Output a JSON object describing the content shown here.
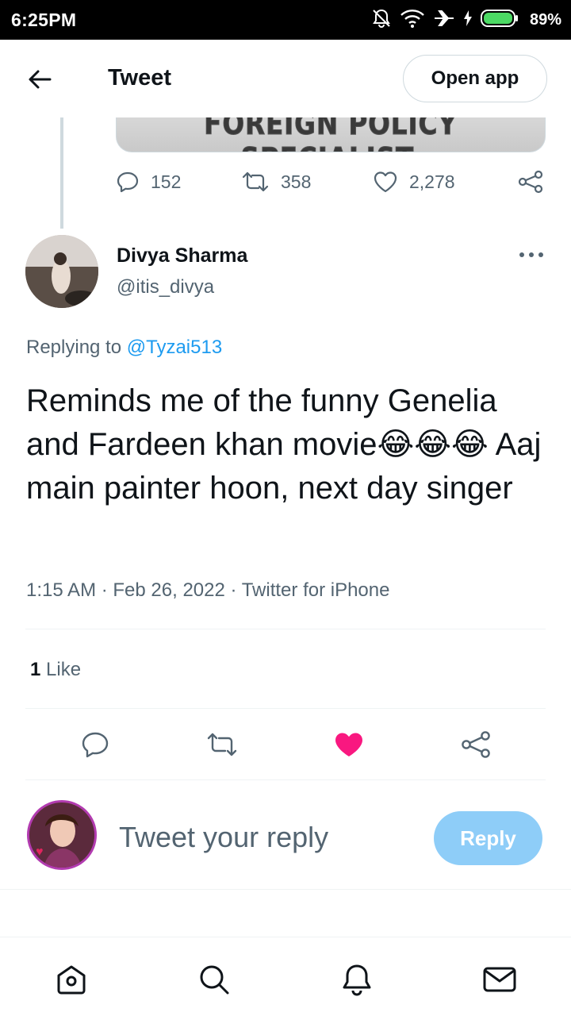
{
  "status_bar": {
    "time": "6:25PM",
    "battery_percent": "89%",
    "icons": [
      "mute-icon",
      "wifi-icon",
      "airplane-icon",
      "charging-icon",
      "battery-icon"
    ]
  },
  "header": {
    "title": "Tweet",
    "open_app_label": "Open app"
  },
  "parent_tweet": {
    "media_caption_text": "FOREIGN POLICY SPECIALIST.",
    "reply_count": "152",
    "retweet_count": "358",
    "like_count": "2,278"
  },
  "tweet": {
    "display_name": "Divya Sharma",
    "handle": "@itis_divya",
    "replying_prefix": "Replying to ",
    "replying_to": "@Tyzai513",
    "text": "Reminds me of the funny Genelia and Fardeen khan movie😂😂😂 Aaj main painter hoon, next day singer",
    "meta": "1:15 AM · Feb 26, 2022 · Twitter for iPhone",
    "likes_count": "1",
    "likes_label": " Like",
    "liked": true
  },
  "composer": {
    "placeholder": "Tweet your reply",
    "reply_button_label": "Reply"
  },
  "bottom_nav": {
    "items": [
      "home-icon",
      "search-icon",
      "notifications-icon",
      "messages-icon"
    ]
  },
  "colors": {
    "accent": "#1d9bf0",
    "like_pink": "#f91880",
    "reply_button_disabled": "#8ecdf8",
    "secondary_text": "#536471"
  }
}
